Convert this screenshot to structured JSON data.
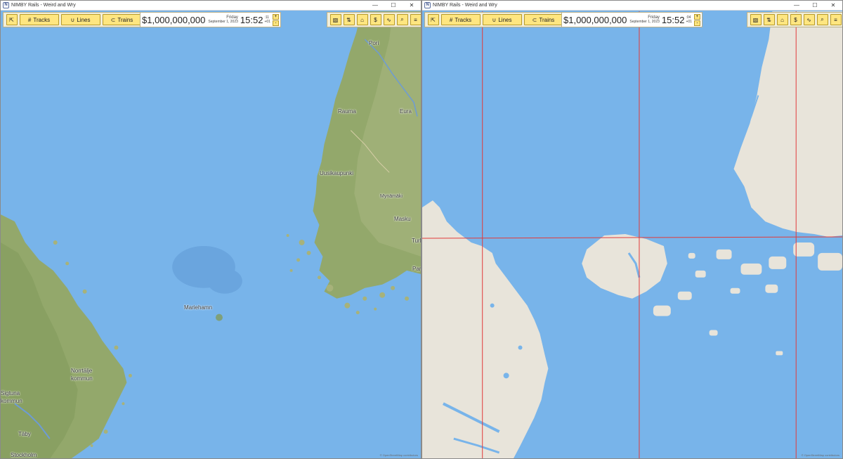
{
  "windows": [
    {
      "title": "NIMBY Rails - Weird and Wry",
      "toolbar": {
        "tracks": "Tracks",
        "lines": "Lines",
        "trains": "Trains"
      },
      "money": "$1,000,000,000",
      "day": "Friday",
      "date": "September 1, 2023",
      "time": "15:52",
      "seconds": ":11",
      "tz": "+01",
      "labels": {
        "pori": "Pori",
        "rauma": "Rauma",
        "eura": "Eura",
        "uusikaupunki": "Uusikaupunki",
        "mynamaki": "Mynämäki",
        "masku": "Masku",
        "turku": "Turk",
        "parainen": "Par",
        "mariehamn": "Mariehamn",
        "norrtalje1": "Norrtälje",
        "norrtalje2": "kommun",
        "sigtuna1": "Sigtuna",
        "sigtuna2": "kommun",
        "taby": "Täby",
        "stockholm": "Stockholm"
      },
      "attribution": "© OpenStreetMap contributors"
    },
    {
      "title": "NIMBY Rails - Weird and Wry",
      "toolbar": {
        "tracks": "Tracks",
        "lines": "Lines",
        "trains": "Trains"
      },
      "money": "$1,000,000,000",
      "day": "Friday",
      "date": "September 1, 2023",
      "time": "15:52",
      "seconds": ":04",
      "tz": "+01",
      "attribution": "© OpenStreetMap contributors"
    }
  ],
  "colors": {
    "water": "#78b4ea",
    "land_sat": "#93a86b",
    "land_flat": "#e8e4da",
    "grid": "#e23a3a",
    "button": "#ffe680"
  },
  "icons": {
    "select": "cursor-icon",
    "tracks": "tracks-icon",
    "lines": "lines-icon",
    "trains": "train-icon",
    "map_layers": "map-layers-icon",
    "sort": "sort-icon",
    "tag": "tag-icon",
    "money": "dollar-icon",
    "route": "route-icon",
    "search": "search-icon",
    "menu": "menu-icon"
  }
}
